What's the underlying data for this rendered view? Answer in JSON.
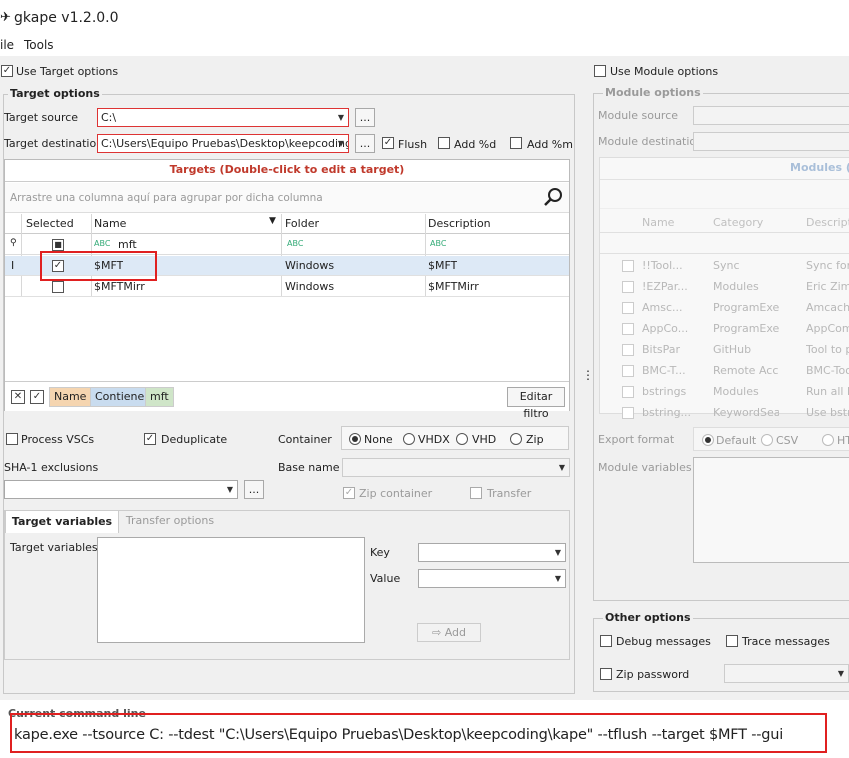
{
  "window": {
    "title": "gkape v1.2.0.0"
  },
  "menu": {
    "file": "ile",
    "tools": "Tools"
  },
  "target_options": {
    "use_label": "Use Target options",
    "group_title": "Target options",
    "source_label": "Target source",
    "source_value": "C:\\",
    "dest_label": "Target destination",
    "dest_value": "C:\\Users\\Equipo Pruebas\\Desktop\\keepcoding\\k",
    "flush_label": "Flush",
    "addd_label": "Add %d",
    "addm_label": "Add %m",
    "ellipsis": "..."
  },
  "targets": {
    "title": "Targets (Double-click to edit a target)",
    "group_hint": "Arrastre una columna aquí para agrupar por dicha columna",
    "columns": [
      "Selected",
      "Name",
      "Folder",
      "Description"
    ],
    "filter_row": {
      "name": "mft"
    },
    "rows": [
      {
        "name": "$MFT",
        "folder": "Windows",
        "description": "$MFT",
        "checked": true
      },
      {
        "name": "$MFTMirr",
        "folder": "Windows",
        "description": "$MFTMirr",
        "checked": false
      }
    ],
    "filter_chips": [
      "Name",
      "Contiene",
      "mft"
    ],
    "edit_filter": "Editar filtro"
  },
  "process": {
    "vsc": "Process VSCs",
    "dedup": "Deduplicate",
    "container_label": "Container",
    "container_options": [
      "None",
      "VHDX",
      "VHD",
      "Zip"
    ],
    "sha1_label": "SHA-1 exclusions",
    "basename_label": "Base name",
    "zip_container": "Zip container",
    "transfer": "Transfer"
  },
  "tabs": [
    "Target variables",
    "Transfer options"
  ],
  "target_vars": {
    "label": "Target variables",
    "key": "Key",
    "value": "Value",
    "add": "Add"
  },
  "module_options": {
    "use_label": "Use Module options",
    "group_title": "Module options",
    "source_label": "Module source",
    "dest_label": "Module destination",
    "modules_title": "Modules (D",
    "columns": [
      "Name",
      "Category",
      "Descripti"
    ],
    "rows": [
      [
        "!!Tool...",
        "Sync",
        "Sync for"
      ],
      [
        "!EZPar...",
        "Modules",
        "Eric Zimm"
      ],
      [
        "Amsc...",
        "ProgramExecuti",
        "Amcache"
      ],
      [
        "AppCo...",
        "ProgramExecuti",
        "AppComp"
      ],
      [
        "BitsPar",
        "GitHub",
        "Tool to pa"
      ],
      [
        "BMC-T...",
        "Remote Access",
        "BMC-Too"
      ],
      [
        "bstrings",
        "Modules",
        "Run all bs"
      ],
      [
        "bstring...",
        "KeywordSearch...",
        "Use bstri"
      ]
    ],
    "export_label": "Export format",
    "export_options": [
      "Default",
      "CSV",
      "HTM"
    ],
    "vars_label": "Module variables"
  },
  "other_options": {
    "title": "Other options",
    "debug": "Debug messages",
    "trace": "Trace messages",
    "zip_pw": "Zip password"
  },
  "command": {
    "label": "Current command line",
    "text": "kape.exe --tsource C: --tdest \"C:\\Users\\Equipo Pruebas\\Desktop\\keepcoding\\kape\" --tflush --target $MFT --gui"
  },
  "colors": {
    "highlight_red": "#e02020",
    "target_title": "#c0392b",
    "chip_name": "#f5d5b0",
    "chip_op": "#c9dcef",
    "chip_val": "#cfe5c8"
  }
}
